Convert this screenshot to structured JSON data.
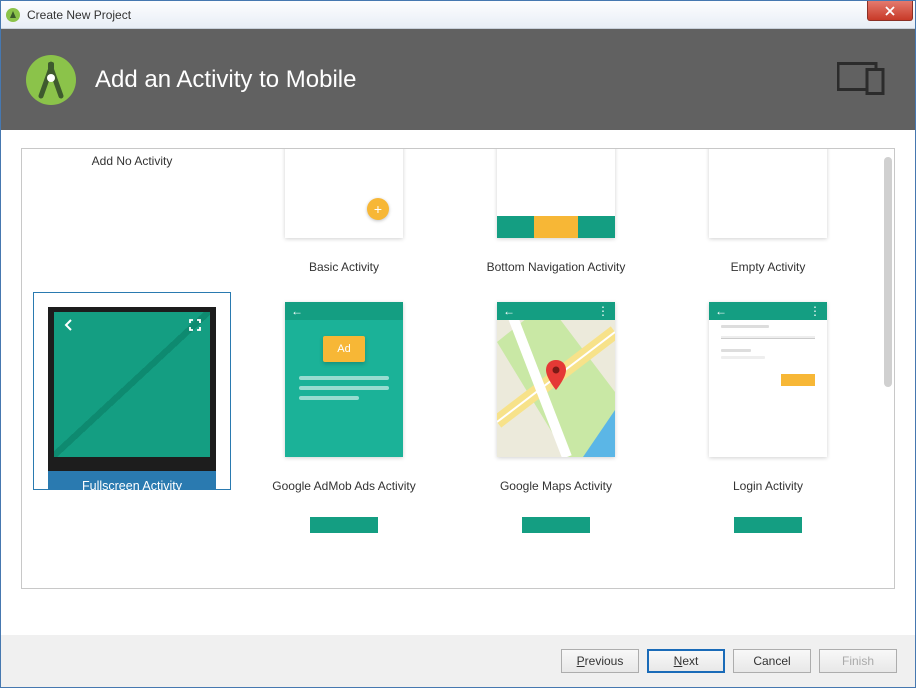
{
  "window": {
    "title": "Create New Project"
  },
  "banner": {
    "heading": "Add an Activity to Mobile"
  },
  "tiles": {
    "no_activity": "Add No Activity",
    "basic": "Basic Activity",
    "bottom_nav": "Bottom Navigation Activity",
    "empty": "Empty Activity",
    "fullscreen": "Fullscreen Activity",
    "admob": "Google AdMob Ads Activity",
    "maps": "Google Maps Activity",
    "login": "Login Activity",
    "ad_label": "Ad"
  },
  "footer": {
    "previous": "Previous",
    "next": "Next",
    "cancel": "Cancel",
    "finish": "Finish"
  }
}
